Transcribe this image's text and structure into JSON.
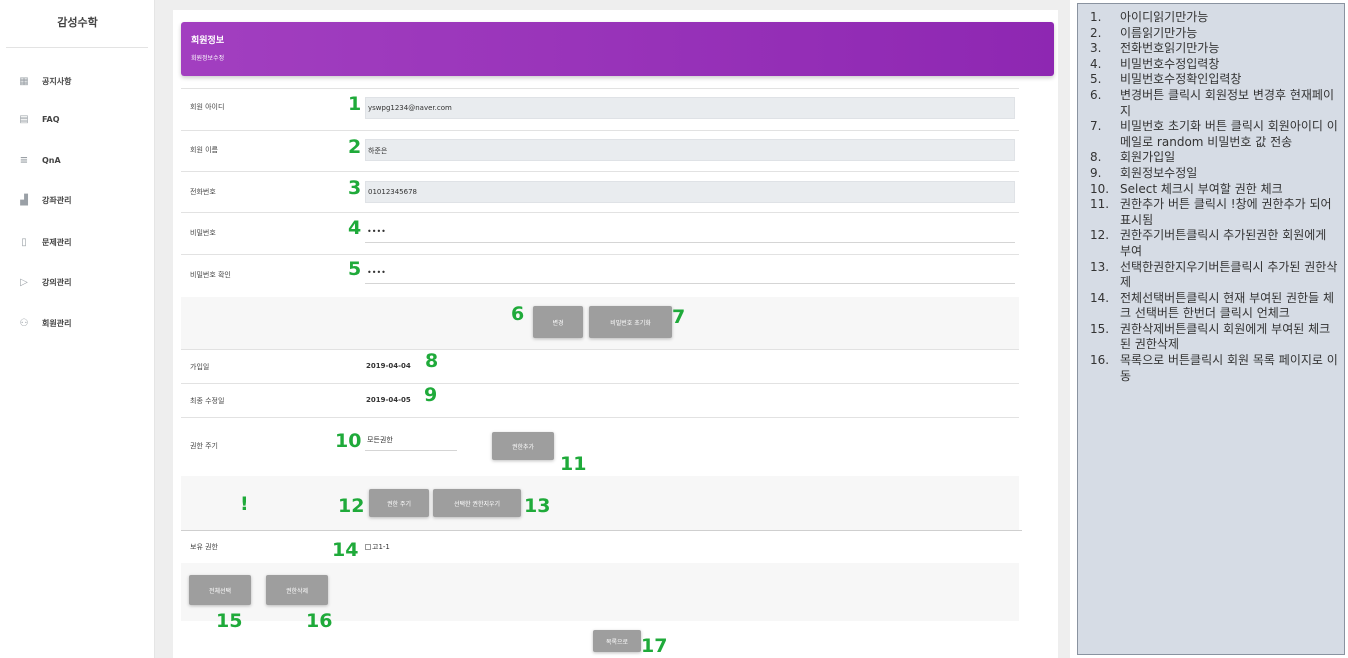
{
  "sidebar": {
    "brand": "감성수학",
    "items": [
      {
        "label": "공지사항",
        "icon": "grid-icon"
      },
      {
        "label": "FAQ",
        "icon": "document-icon"
      },
      {
        "label": "QnA",
        "icon": "list-icon"
      },
      {
        "label": "강좌관리",
        "icon": "chart-icon"
      },
      {
        "label": "문제관리",
        "icon": "book-icon"
      },
      {
        "label": "강의관리",
        "icon": "play-icon"
      },
      {
        "label": "회원관리",
        "icon": "users-icon"
      }
    ]
  },
  "header": {
    "title": "회원정보",
    "subtitle": "회원정보수정"
  },
  "form": {
    "id_label": "회원 아이디",
    "id_value": "yswpg1234@naver.com",
    "name_label": "회원 이름",
    "name_value": "하준은",
    "phone_label": "전화번호",
    "phone_value": "01012345678",
    "pw_label": "비밀번호",
    "pw_value": "••••",
    "pw_confirm_label": "비밀번호 확인",
    "pw_confirm_value": "••••",
    "change_button": "변경",
    "reset_pw_button": "비밀번호 초기화",
    "joined_label": "가입일",
    "joined_value": "2019-04-04",
    "modified_label": "최종 수정일",
    "modified_value": "2019-04-05",
    "grant_label": "권한 주기",
    "grant_select_value": "모든권한",
    "add_grant_button": "권한추가",
    "exclaim": "!",
    "give_grant_button": "권한 주기",
    "remove_selected_button": "선택한 권한지우기",
    "owned_label": "보유 권한",
    "owned_item": "고1-1",
    "select_all_button": "전체선택",
    "delete_grant_button": "권한삭제",
    "list_button": "목록으로"
  },
  "markers": [
    "1",
    "2",
    "3",
    "4",
    "5",
    "6",
    "7",
    "8",
    "9",
    "10",
    "11",
    "12",
    "13",
    "14",
    "15",
    "16",
    "17"
  ],
  "notes": [
    {
      "n": "1.",
      "text": "아이디읽기만가능"
    },
    {
      "n": "2.",
      "text": "이름읽기만가능"
    },
    {
      "n": "3.",
      "text": "전화번호읽기만가능"
    },
    {
      "n": "4.",
      "text": "비밀번호수정입력창"
    },
    {
      "n": "5.",
      "text": "비밀번호수정확인입력창"
    },
    {
      "n": "6.",
      "text": "변경버튼 클릭시 회원정보 변경후 현재페이지"
    },
    {
      "n": "7.",
      "text": "비밀번호 초기화 버튼 클릭시 회원아이디 이메일로 random 비밀번호 값 전송"
    },
    {
      "n": "8.",
      "text": "회원가입일"
    },
    {
      "n": "9.",
      "text": "회원정보수정일"
    },
    {
      "n": "10.",
      "text": "Select 체크시 부여할 권한 체크"
    },
    {
      "n": "11.",
      "text": "권한추가 버튼 클릭시 !창에 권한추가 되어 표시됨"
    },
    {
      "n": "12.",
      "text": "권한주기버튼클릭시 추가된권한 회원에게 부여"
    },
    {
      "n": "13.",
      "text": "선택한권한지우기버튼클릭시 추가된 권한삭제"
    },
    {
      "n": "14.",
      "text": "전체선택버튼클릭시 현재 부여된 권한들 체크 선택버튼 한번더 클릭시 언체크"
    },
    {
      "n": "15.",
      "text": "권한삭제버튼클릭시 회원에게 부여된 체크된 권한삭제"
    },
    {
      "n": "16.",
      "text": "목록으로 버튼클릭시 회원 목록 페이지로 이동"
    }
  ]
}
